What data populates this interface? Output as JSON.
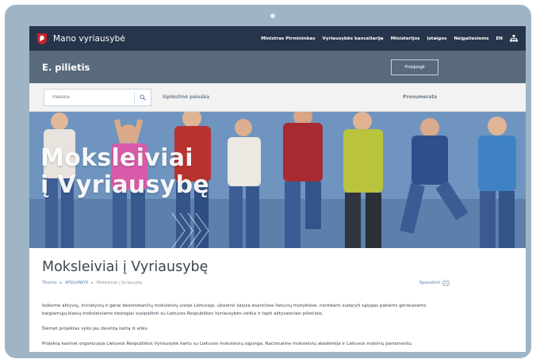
{
  "header": {
    "site_title": "Mano vyriausybė",
    "nav": [
      "Ministras Pirmininkas",
      "Vyriausybės kanceliarija",
      "Ministerijos",
      "Įstaigos",
      "Neįgaliesiems",
      "EN"
    ]
  },
  "band": {
    "title": "E. pilietis",
    "login_label": "Prisijungti"
  },
  "search": {
    "placeholder": "Paieška",
    "advanced_label": "Išplėstinė paieška",
    "subscribe_label": "Prenumerata"
  },
  "hero": {
    "line1": "Moksleiviai",
    "line2": "į Vyriausybę"
  },
  "page": {
    "title": "Moksleiviai į Vyriausybę",
    "breadcrumb": [
      "Titulinis",
      "APSILANKYK",
      "Moksleiviai į Vyriausybę"
    ],
    "print_label": "Spausdinti",
    "paragraphs": [
      "Ieškome aktyvių, iniciatyvių ir gerai besimokančių moksleivių visoje Lietuvoje, užsienio šalyse esančiose lietuvių mokyklose, norėdami sudaryti sąlygas patiems geriausiems baigiamųjų klasių moksleiviams tiesiogiai susipažinti su Lietuvos Respublikos Vyriausybės veikla ir tapti aktyvesniais piliečiais.",
      "Šiemet projektas vyko jau devintą kartą iš eilės.",
      "Projektą kasmet organizuoja Lietuvos Respublikos Vyriausybė kartu su Lietuvos moksleivių sąjunga, Nacionaline moksleivių akademija ir Lietuvos mokinių parlamentu."
    ]
  },
  "colors": {
    "device_frame": "#9fb4c4",
    "topbar": "#26354b",
    "band": "#596a7d",
    "link": "#5b86b8"
  },
  "icons": {
    "crest": "crest-icon",
    "search": "search-icon",
    "sitemap": "sitemap-icon",
    "print": "printer-icon"
  }
}
